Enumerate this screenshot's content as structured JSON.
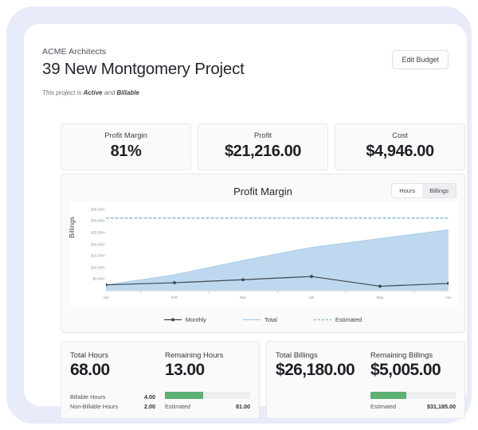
{
  "header": {
    "company": "ACME Architects",
    "title": "39 New Montgomery Project",
    "status_prefix": "This project is ",
    "status_one": "Active",
    "status_join": " and ",
    "status_two": "Billable",
    "edit_budget_label": "Edit Budget"
  },
  "kpis": [
    {
      "label": "Profit Margin",
      "value": "81%"
    },
    {
      "label": "Profit",
      "value": "$21,216.00"
    },
    {
      "label": "Cost",
      "value": "$4,946.00"
    }
  ],
  "chart_panel": {
    "title": "Profit Margin",
    "toggle": {
      "hours_label": "Hours",
      "billings_label": "Billings",
      "selected": "Billings"
    }
  },
  "hours_panel": {
    "total_label": "Total Hours",
    "total_value": "68.00",
    "billable_label": "Billable Hours",
    "billable_value": "4.00",
    "nonbillable_label": "Non-Billable Hours",
    "nonbillable_value": "2.00",
    "remaining_label": "Remaining Hours",
    "remaining_value": "13.00",
    "estimated_label": "Estimated",
    "estimated_value": "81.00",
    "progress_percent": 45
  },
  "billings_panel": {
    "total_label": "Total Billings",
    "total_value": "$26,180.00",
    "remaining_label": "Remaining Billings",
    "remaining_value": "$5,005.00",
    "estimated_label": "Estimated",
    "estimated_value": "$31,185.00",
    "progress_percent": 42
  },
  "colors": {
    "area_fill": "#bed8ef",
    "total_line": "#a8cbe8",
    "monthly_line": "#3d4852",
    "estimated_line": "#7fb2e0",
    "progress_green": "#5cb173",
    "frame": "#e8ebfa"
  },
  "chart_data": {
    "type": "area",
    "title": "Profit Margin",
    "xlabel": "",
    "ylabel": "Billings",
    "categories": [
      "Jan",
      "Feb",
      "Mar",
      "Apr",
      "May",
      "Jun"
    ],
    "ytick_labels": [
      "$35,000",
      "$30,000",
      "$25,000",
      "$20,000",
      "$15,000",
      "$10,000",
      "$5,000"
    ],
    "ytick_values": [
      35000,
      30000,
      25000,
      20000,
      15000,
      10000,
      5000
    ],
    "ylim": [
      0,
      37000
    ],
    "grid": false,
    "legend_position": "bottom",
    "series": [
      {
        "name": "Monthly",
        "type": "line",
        "marker": true,
        "color": "#3d4852",
        "values": [
          2500,
          3400,
          4700,
          6100,
          1900,
          3100
        ]
      },
      {
        "name": "Total",
        "type": "area",
        "color": "#a8cbe8",
        "fill": "#bed8ef",
        "values": [
          2500,
          6800,
          13000,
          18600,
          22400,
          26180
        ]
      },
      {
        "name": "Estimated",
        "type": "dotted-line",
        "color": "#7fb2e0",
        "constant": 31185,
        "values": [
          31185,
          31185,
          31185,
          31185,
          31185,
          31185
        ]
      }
    ]
  }
}
